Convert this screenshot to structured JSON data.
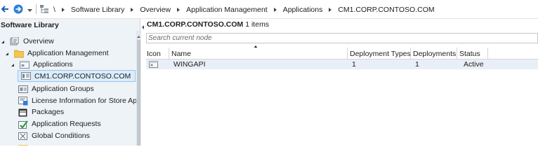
{
  "breadcrumb": [
    "Software Library",
    "Overview",
    "Application Management",
    "Applications",
    "CM1.CORP.CONTOSO.COM"
  ],
  "breadcrumb_root": "\\",
  "left_pane": {
    "title": "Software Library",
    "items": [
      {
        "label": "Overview",
        "icon": "overview-icon"
      },
      {
        "label": "Application Management",
        "icon": "folder-icon"
      },
      {
        "label": "Applications",
        "icon": "applications-icon"
      },
      {
        "label": "CM1.CORP.CONTOSO.COM",
        "icon": "server-icon"
      },
      {
        "label": "Application Groups",
        "icon": "application-groups-icon"
      },
      {
        "label": "License Information for Store Apps",
        "icon": "license-icon"
      },
      {
        "label": "Packages",
        "icon": "packages-icon"
      },
      {
        "label": "Application Requests",
        "icon": "application-requests-icon"
      },
      {
        "label": "Global Conditions",
        "icon": "global-conditions-icon"
      }
    ]
  },
  "right_pane": {
    "node": "CM1.CORP.CONTOSO.COM",
    "count_text": "1 items",
    "search_placeholder": "Search current node",
    "columns": [
      "Icon",
      "Name",
      "Deployment Types",
      "Deployments",
      "Status"
    ],
    "rows": [
      {
        "name": "WINGAPI",
        "deployment_types": "1",
        "deployments": "1",
        "status": "Active",
        "icon": "application-icon"
      }
    ]
  },
  "colors": {
    "tree_background": "#eef3f8",
    "selection": "#dcecfa",
    "selected_row": "#e9eff6",
    "folder": "#f3c553"
  }
}
